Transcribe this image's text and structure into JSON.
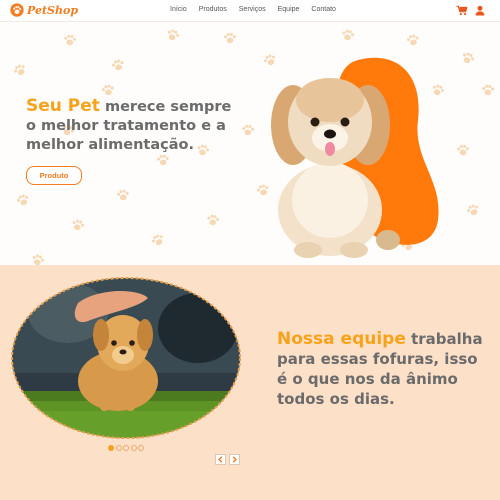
{
  "brand": {
    "name": "PetShop",
    "logo_icon": "paw-logo-icon",
    "color": "#f47c20"
  },
  "nav": {
    "links": [
      "Início",
      "Produtos",
      "Serviços",
      "Equipe",
      "Contato"
    ],
    "icons": [
      "cart-icon",
      "user-icon"
    ]
  },
  "hero": {
    "highlight": "Seu Pet",
    "text": " merece sempre o melhor tratamento e a melhor alimentação.",
    "button": "Produto",
    "image": "puppy-photo"
  },
  "team": {
    "highlight": "Nossa equipe",
    "text": " trabalha para essas fofuras, isso é o que nos da ânimo todos os dias.",
    "image": "golden-puppy-photo",
    "slides": 5,
    "active_slide": 1,
    "prev_icon": "chevron-left-icon",
    "next_icon": "chevron-right-icon"
  },
  "colors": {
    "accent": "#f7a21b",
    "orange": "#f47c20",
    "peach": "#fde0c8",
    "text": "#6b6b6b"
  }
}
